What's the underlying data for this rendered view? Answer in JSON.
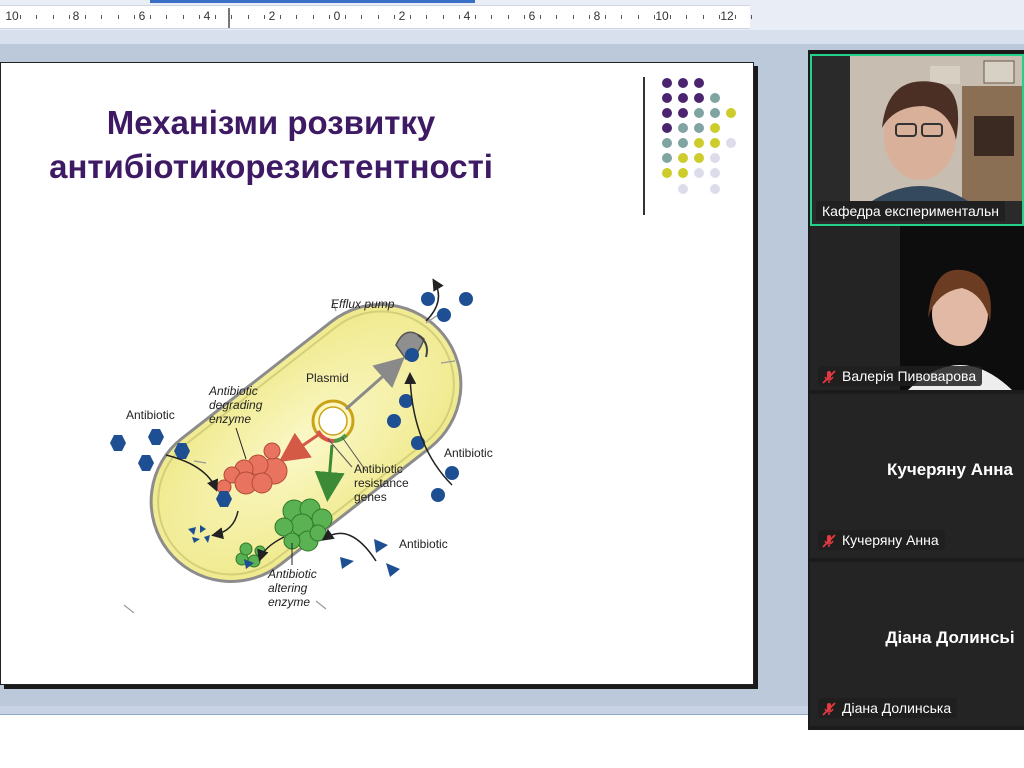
{
  "ruler": {
    "numbers": [
      "10",
      "8",
      "6",
      "4",
      "2",
      "0",
      "2",
      "4",
      "6",
      "8",
      "10",
      "12"
    ]
  },
  "slide": {
    "title_line1": "Механізми розвитку",
    "title_line2": "антибіотикорезистентності",
    "diagram": {
      "efflux_pump": "Efflux pump",
      "plasmid": "Plasmid",
      "degrading_line1": "Antibiotic",
      "degrading_line2": "degrading",
      "degrading_line3": "enzyme",
      "antibiotic_left": "Antibiotic",
      "antibiotic_right": "Antibiotic",
      "antibiotic_bottom": "Antibiotic",
      "genes_line1": "Antibiotic",
      "genes_line2": "resistance",
      "genes_line3": "genes",
      "altering_line1": "Antibiotic",
      "altering_line2": "altering",
      "altering_line3": "enzyme"
    },
    "colors": {
      "title": "#3d1a63",
      "cell_fill": "#f7f3a6",
      "antibiotic": "#1f4f93",
      "degrading_enzyme": "#e8735f",
      "altering_enzyme": "#4fa14a"
    }
  },
  "gallery": {
    "accent": "#23d18b",
    "participants": [
      {
        "name": "Кафедра експериментальн",
        "muted": false,
        "video": true
      },
      {
        "name": "Валерія Пивоварова",
        "muted": true,
        "video": true
      },
      {
        "name": "Кучеряну Анна",
        "display_name": "Кучеряну Анна",
        "muted": true,
        "video": false
      },
      {
        "name": "Діана Долинська",
        "display_name": "Діана Долинсьі",
        "muted": true,
        "video": false
      }
    ],
    "icons": {
      "muted": "mic-muted-icon"
    }
  }
}
